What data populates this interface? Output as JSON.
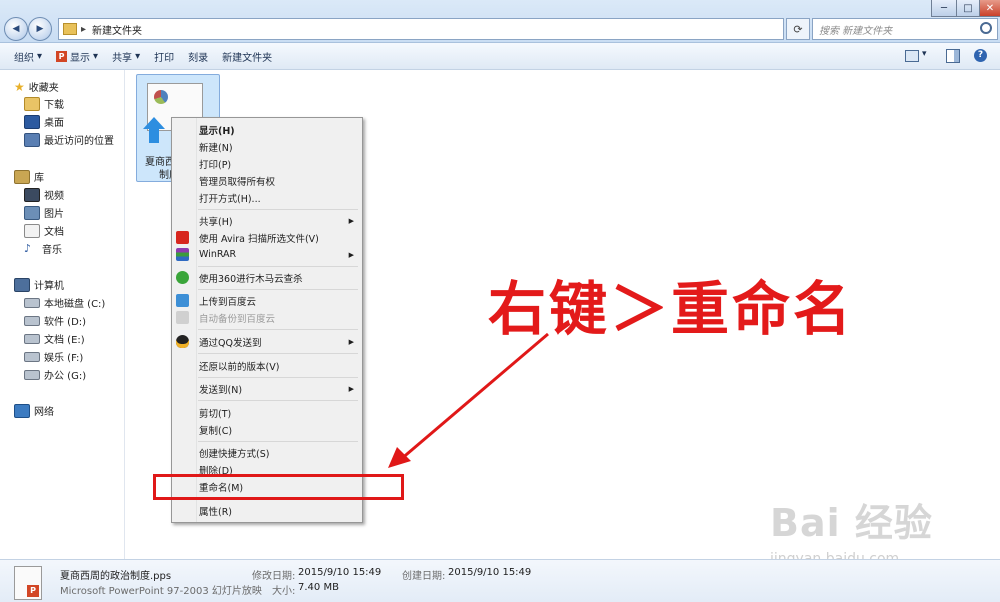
{
  "window": {
    "address_path": "新建文件夹",
    "search_placeholder": "搜索 新建文件夹",
    "refresh_glyph": "⟳",
    "back_glyph": "◀",
    "forward_glyph": "▶",
    "minimize_glyph": "─",
    "maximize_glyph": "□",
    "close_glyph": "✕"
  },
  "toolbar": {
    "organize": "组织",
    "display": "显示",
    "share": "共享",
    "print": "打印",
    "burn": "刻录",
    "new_folder": "新建文件夹",
    "dropdown_glyph": "▾",
    "help_glyph": "?"
  },
  "sidebar": {
    "favorites": "收藏夹",
    "downloads": "下载",
    "desktop": "桌面",
    "recent": "最近访问的位置",
    "libraries": "库",
    "videos": "视频",
    "pictures": "图片",
    "documents": "文档",
    "music": "音乐",
    "computer": "计算机",
    "drive_c": "本地磁盘 (C:)",
    "drive_d": "软件 (D:)",
    "drive_e": "文档 (E:)",
    "drive_f": "娱乐 (F:)",
    "drive_g": "办公 (G:)",
    "network": "网络"
  },
  "file": {
    "label_line1": "夏商西",
    "label_line2": "制度"
  },
  "context_menu": {
    "items": [
      {
        "label": "显示(H)",
        "bold": true
      },
      {
        "label": "新建(N)"
      },
      {
        "label": "打印(P)"
      },
      {
        "label": "管理员取得所有权"
      },
      {
        "label": "打开方式(H)..."
      },
      {
        "label": "共享(H)",
        "submenu": true
      },
      {
        "label": "使用 Avira 扫描所选文件(V)"
      },
      {
        "label": "WinRAR",
        "submenu": true
      },
      {
        "label": "使用360进行木马云查杀"
      },
      {
        "label": "上传到百度云"
      },
      {
        "label": "自动备份到百度云",
        "disabled": true
      },
      {
        "label": "通过QQ发送到",
        "submenu": true
      },
      {
        "label": "还原以前的版本(V)"
      },
      {
        "label": "发送到(N)",
        "submenu": true
      },
      {
        "label": "剪切(T)"
      },
      {
        "label": "复制(C)"
      },
      {
        "label": "创建快捷方式(S)"
      },
      {
        "label": "删除(D)"
      },
      {
        "label": "重命名(M)"
      },
      {
        "label": "属性(R)"
      }
    ],
    "submenu_glyph": "▶"
  },
  "annotation": {
    "text": "右键＞重命名",
    "color": "#e31a1a"
  },
  "details": {
    "filename": "夏商西周的政治制度.pps",
    "filetype": "Microsoft PowerPoint 97-2003 幻灯片放映",
    "modified_label": "修改日期:",
    "modified_value": "2015/9/10 15:49",
    "size_label": "大小:",
    "size_value": "7.40 MB",
    "created_label": "创建日期:",
    "created_value": "2015/9/10 15:49"
  },
  "watermark": {
    "brand": "Bai 经验",
    "url": "jingyan.baidu.com"
  }
}
